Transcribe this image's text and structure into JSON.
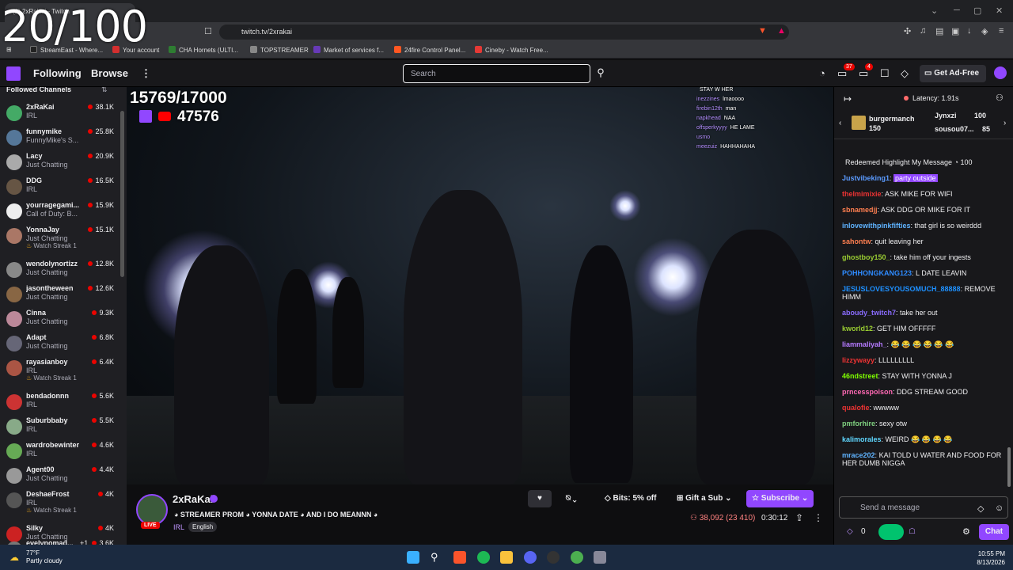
{
  "overlay_counter": "20/100",
  "browser": {
    "tab_title": "(2) 2xRaKai - Twitch",
    "url": "twitch.tv/2xrakai",
    "bookmarks": [
      {
        "label": "StreamEast - Where...",
        "color": "#222"
      },
      {
        "label": "Your account",
        "color": "#d32f2f"
      },
      {
        "label": "CHA Hornets (ULTI...",
        "color": "#2e7d32"
      },
      {
        "label": "TOPSTREAMER",
        "color": "#888"
      },
      {
        "label": "Market of services f...",
        "color": "#673ab7"
      },
      {
        "label": "24fire Control Panel...",
        "color": "#ff5722"
      },
      {
        "label": "Cineby - Watch Free...",
        "color": "#e53935"
      }
    ]
  },
  "twitch_nav": {
    "following": "Following",
    "browse": "Browse",
    "more": "⋮",
    "search_placeholder": "Search",
    "notif_badge_1": "37",
    "notif_badge_2": "4",
    "ad_free": "Get Ad-Free"
  },
  "sidebar": {
    "title": "Followed Channels",
    "channels": [
      {
        "name": "2xRaKai",
        "game": "IRL",
        "viewers": "38.1K",
        "color": "#4a6"
      },
      {
        "name": "funnymike",
        "game": "FunnyMike's S...",
        "viewers": "25.8K",
        "color": "#579"
      },
      {
        "name": "Lacy",
        "game": "Just Chatting",
        "viewers": "20.9K",
        "color": "#aaa"
      },
      {
        "name": "DDG",
        "game": "IRL",
        "viewers": "16.5K",
        "color": "#654"
      },
      {
        "name": "yourragegami...",
        "game": "Call of Duty: B...",
        "viewers": "15.9K",
        "color": "#eee"
      },
      {
        "name": "YonnaJay",
        "game": "Just Chatting",
        "viewers": "15.1K",
        "color": "#a76",
        "watch": "Watch Streak 1"
      },
      {
        "name": "wendolynortizz",
        "game": "Just Chatting",
        "viewers": "12.8K",
        "color": "#888"
      },
      {
        "name": "jasontheween",
        "game": "Just Chatting",
        "viewers": "12.6K",
        "color": "#864"
      },
      {
        "name": "Cinna",
        "game": "Just Chatting",
        "viewers": "9.3K",
        "color": "#b89"
      },
      {
        "name": "Adapt",
        "game": "Just Chatting",
        "viewers": "6.8K",
        "color": "#667"
      },
      {
        "name": "rayasianboy",
        "game": "IRL",
        "viewers": "6.4K",
        "color": "#a54",
        "watch": "Watch Streak 1"
      },
      {
        "name": "bendadonnn",
        "game": "IRL",
        "viewers": "5.6K",
        "color": "#c33"
      },
      {
        "name": "Suburbbaby",
        "game": "IRL",
        "viewers": "5.5K",
        "color": "#8a8"
      },
      {
        "name": "wardrobewinter",
        "game": "IRL",
        "viewers": "4.6K",
        "color": "#6a5"
      },
      {
        "name": "Agent00",
        "game": "Just Chatting",
        "viewers": "4.4K",
        "color": "#999"
      },
      {
        "name": "DeshaeFrost",
        "game": "IRL",
        "viewers": "4K",
        "color": "#555",
        "watch": "Watch Streak 1"
      },
      {
        "name": "Silky",
        "game": "Just Chatting",
        "viewers": "4K",
        "color": "#c22"
      },
      {
        "name": "evelynomad...",
        "game": "",
        "viewers": "3.6K",
        "extra": "+1",
        "color": "#777"
      }
    ]
  },
  "video": {
    "overlay_count": "15769/17000",
    "overlay_viewers": "47576",
    "overlay_chat": [
      {
        "user": "",
        "text": "STAY W HER"
      },
      {
        "user": "inezzines",
        "text": "lmaoooo"
      },
      {
        "user": "firebin12th",
        "text": "man"
      },
      {
        "user": "napkhead",
        "text": "NAA"
      },
      {
        "user": "offsperkyyyy",
        "text": "HE LAME"
      },
      {
        "user": "usmo",
        "text": ""
      },
      {
        "user": "meezuiz",
        "text": "HAHHAHAHA"
      }
    ]
  },
  "stream_info": {
    "channel": "2xRaKai",
    "live": "LIVE",
    "title": "◕ STREAMER PROM ◕ YONNA DATE ◕ AND I DO MEANNN ◕",
    "category": "IRL",
    "tag": "English",
    "bits_label": "Bits: 5% off",
    "gift_label": "Gift a Sub",
    "subscribe_label": "Subscribe",
    "view_count": "38,092 (23 410)",
    "uptime": "0:30:12"
  },
  "chat": {
    "latency": "Latency: 1.91s",
    "leaderboard": [
      {
        "name": "burgermanch",
        "value": "150"
      },
      {
        "name": "Jynxzi",
        "value": "100"
      },
      {
        "name": "sousou07...",
        "value": "85"
      }
    ],
    "redeem_text": "Redeemed Highlight My Message",
    "redeem_cost": "100",
    "messages": [
      {
        "user": "Justvibeking1",
        "color": "#5b9bff",
        "text": "party outside",
        "highlight": true
      },
      {
        "user": "thelmimixie",
        "color": "#e33",
        "text": "ASK MIKE FOR WIFI"
      },
      {
        "user": "sbnamedjj",
        "color": "#ff7f50",
        "text": "ASK DDG OR MIKE FOR IT"
      },
      {
        "user": "inlovewithpinkfifties",
        "color": "#5fb3ff",
        "text": "that girl is so weirddd"
      },
      {
        "user": "sahontw",
        "color": "#ff7f50",
        "text": "quit leaving her"
      },
      {
        "user": "ghostboy150_",
        "color": "#9acd32",
        "text": "take him off your ingests"
      },
      {
        "user": "POHHONGKANG123",
        "color": "#2e8bff",
        "text": "L DATE LEAVIN"
      },
      {
        "user": "JESUSLOVESYOUSOMUCH_88888",
        "color": "#1e90ff",
        "text": "REMOVE HIMM"
      },
      {
        "user": "aboudy_twitch7",
        "color": "#8a6cff",
        "text": "take her out"
      },
      {
        "user": "kworld12",
        "color": "#9acd32",
        "text": "GET HIM OFFFFF"
      },
      {
        "user": "liammaliyah_",
        "color": "#b57aff",
        "text": "😂 😂 😂 😂 😂 😂"
      },
      {
        "user": "lizzywayy",
        "color": "#e33",
        "text": "LLLLLLLLL"
      },
      {
        "user": "46ndstreet",
        "color": "#7fff00",
        "text": "STAY WITH YONNA J"
      },
      {
        "user": "prncesspoison",
        "color": "#ff69b4",
        "text": "DDG STREAM GOOD"
      },
      {
        "user": "qualofie",
        "color": "#e33",
        "text": "wwwww"
      },
      {
        "user": "pmforhire",
        "color": "#7fd07f",
        "text": "sexy otw"
      },
      {
        "user": "kalimorales",
        "color": "#5fd7ff",
        "text": "WEIRD 😂 😂 😂 😂"
      },
      {
        "user": "mrace202",
        "color": "#5fb3ff",
        "text": "KAI TOLD U WATER AND FOOD FOR HER DUMB NIGGA"
      }
    ],
    "input_placeholder": "Send a message",
    "points": "0",
    "chat_button": "Chat"
  },
  "taskbar": {
    "temp": "77°F",
    "weather": "Partly cloudy",
    "time": "10:55 PM",
    "date": "8/13/2026"
  }
}
